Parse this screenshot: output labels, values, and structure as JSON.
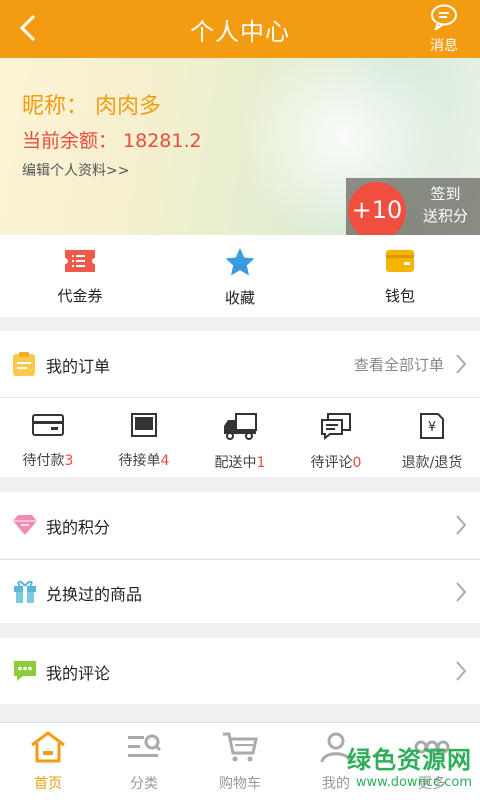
{
  "header": {
    "title": "个人中心",
    "message_label": "消息"
  },
  "profile": {
    "nickname": "昵称： 肉肉多",
    "balance": "当前余额： 18281.2",
    "edit_link": "编辑个人资料>>"
  },
  "signin": {
    "points": "+10",
    "line1": "签到",
    "line2": "送积分"
  },
  "quick_actions": [
    {
      "label": "代金券",
      "icon": "coupon-icon"
    },
    {
      "label": "收藏",
      "icon": "star-icon"
    },
    {
      "label": "钱包",
      "icon": "wallet-icon"
    }
  ],
  "orders": {
    "title": "我的订单",
    "view_all": "查看全部订单",
    "statuses": [
      {
        "label": "待付款",
        "count": "3",
        "icon": "card-icon"
      },
      {
        "label": "待接单",
        "count": "4",
        "icon": "inbox-icon"
      },
      {
        "label": "配送中",
        "count": "1",
        "icon": "truck-icon"
      },
      {
        "label": "待评论",
        "count": "0",
        "icon": "comment-icon"
      },
      {
        "label": "退款/退货",
        "count": "",
        "icon": "refund-icon"
      }
    ]
  },
  "menu": {
    "points": "我的积分",
    "redeemed": "兑换过的商品",
    "reviews": "我的评论"
  },
  "tabbar": [
    {
      "label": "首页",
      "icon": "home-icon",
      "active": true
    },
    {
      "label": "分类",
      "icon": "category-icon",
      "active": false
    },
    {
      "label": "购物车",
      "icon": "cart-icon",
      "active": false
    },
    {
      "label": "我的",
      "icon": "user-icon",
      "active": false
    },
    {
      "label": "更多",
      "icon": "more-icon",
      "active": false
    }
  ],
  "watermark": {
    "line1": "绿色资源网",
    "line2": "www.downcc.com"
  },
  "colors": {
    "accent": "#f39c12",
    "highlight": "#e74c3c",
    "watermark": "#2fae5a"
  }
}
